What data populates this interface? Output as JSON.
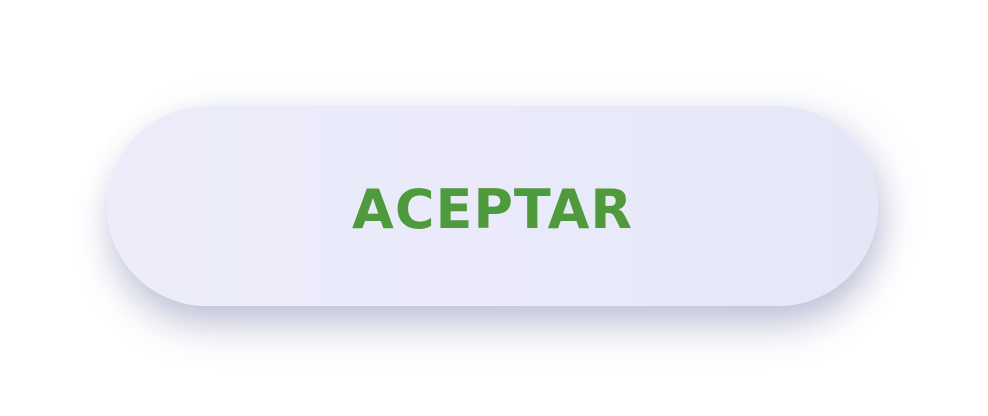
{
  "button": {
    "label": "ACEPTAR",
    "text_color": "#4f9a3c",
    "background_color": "#eaebfa"
  }
}
